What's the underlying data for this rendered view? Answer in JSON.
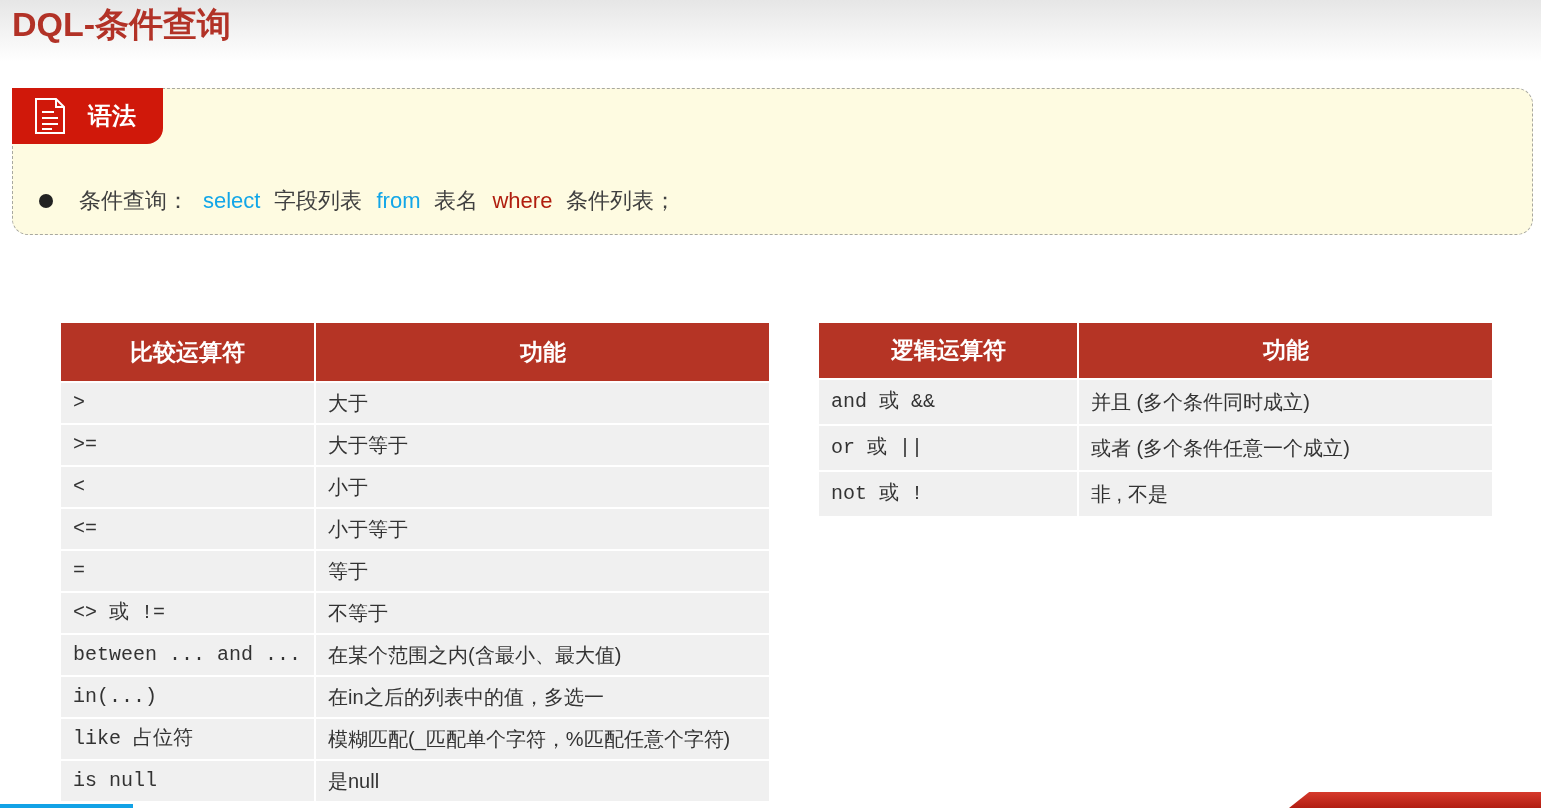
{
  "title": "DQL-条件查询",
  "syntax": {
    "tab_label": "语法",
    "bullet": [
      {
        "kind": "text",
        "text": "条件查询："
      },
      {
        "kind": "keyword",
        "text": "select"
      },
      {
        "kind": "text",
        "text": "字段列表"
      },
      {
        "kind": "keyword",
        "text": "from"
      },
      {
        "kind": "text",
        "text": "表名"
      },
      {
        "kind": "clause",
        "text": "where"
      },
      {
        "kind": "text",
        "text": "条件列表；"
      }
    ]
  },
  "comparison_table": {
    "columns": [
      "比较运算符",
      "功能"
    ],
    "rows": [
      [
        ">",
        "大于"
      ],
      [
        ">=",
        "大于等于"
      ],
      [
        "<",
        "小于"
      ],
      [
        "<=",
        "小于等于"
      ],
      [
        "=",
        "等于"
      ],
      [
        "<>  或 !=",
        "不等于"
      ],
      [
        "between ... and ...",
        "在某个范围之内(含最小、最大值)"
      ],
      [
        "in(...)",
        "在in之后的列表中的值，多选一"
      ],
      [
        "like  占位符",
        "模糊匹配(_匹配单个字符，%匹配任意个字符)"
      ],
      [
        "is null",
        "是null"
      ]
    ]
  },
  "logic_table": {
    "columns": [
      "逻辑运算符",
      "功能"
    ],
    "rows": [
      [
        "and  或  &&",
        "并且 (多个条件同时成立)"
      ],
      [
        "or  或  ||",
        "或者 (多个条件任意一个成立)"
      ],
      [
        "not  或  !",
        "非 , 不是"
      ]
    ]
  },
  "video_progress": {
    "level": 0.086
  }
}
